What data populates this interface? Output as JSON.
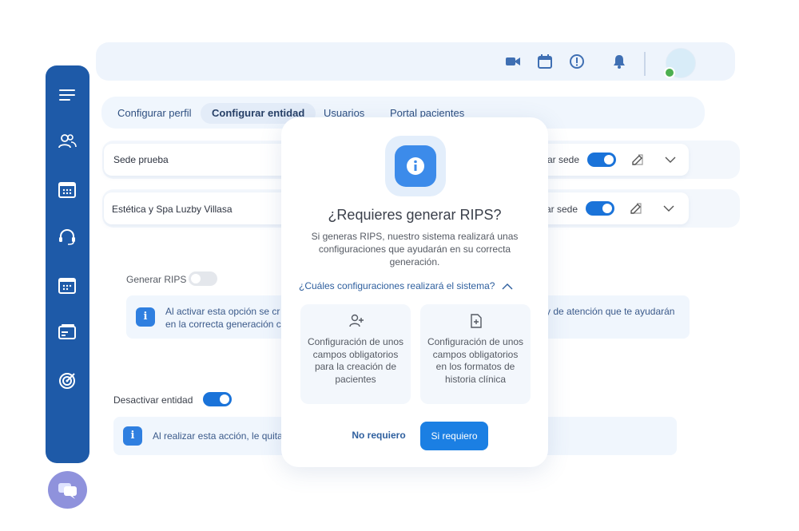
{
  "topbar": {
    "icons": [
      "video-icon",
      "calendar-icon",
      "alert-icon",
      "bell-icon"
    ],
    "avatar_status": "online"
  },
  "sidebar": {
    "icons": [
      "menu-icon",
      "users-icon",
      "calendar-icon",
      "headset-icon",
      "calendar-grid-icon",
      "wallet-icon",
      "target-icon"
    ],
    "color": "#1e5aa8"
  },
  "tabs": [
    {
      "label": "Configurar perfil"
    },
    {
      "label": "Configurar entidad"
    },
    {
      "label": "Usuarios"
    },
    {
      "label": "Portal pacientes"
    }
  ],
  "sedes": [
    {
      "name": "Sede prueba",
      "toggle_label": "ar sede"
    },
    {
      "name": "Estética y Spa Luzby Villasa",
      "toggle_label": "ar sede"
    }
  ],
  "rips": {
    "label": "Generar RIPS",
    "info_line1_left": "Al activar esta opción se cr",
    "info_line1_right": "y de atención que te ayudarán",
    "info_line2": "en la correcta generación c"
  },
  "desactivar": {
    "label": "Desactivar entidad",
    "info": "Al realizar esta acción, le quita"
  },
  "modal": {
    "title": "¿Requieres generar RIPS?",
    "description": "Si generas RIPS, nuestro sistema realizará unas configuraciones que ayudarán en su correcta generación.",
    "expand_link": "¿Cuáles configuraciones realizará el sistema?",
    "cards": [
      {
        "icon": "user-add-icon",
        "text": "Configuración de unos campos obligatorios para la creación de pacientes"
      },
      {
        "icon": "file-add-icon",
        "text": "Configuración de unos campos obligatorios en los formatos de historia clínica"
      }
    ],
    "btn_no": "No requiero",
    "btn_yes": "Si requiero"
  },
  "colors": {
    "primary": "#1b7fe3",
    "sidebar": "#1e5aa8",
    "chat_bubble": "#8f92dc"
  }
}
